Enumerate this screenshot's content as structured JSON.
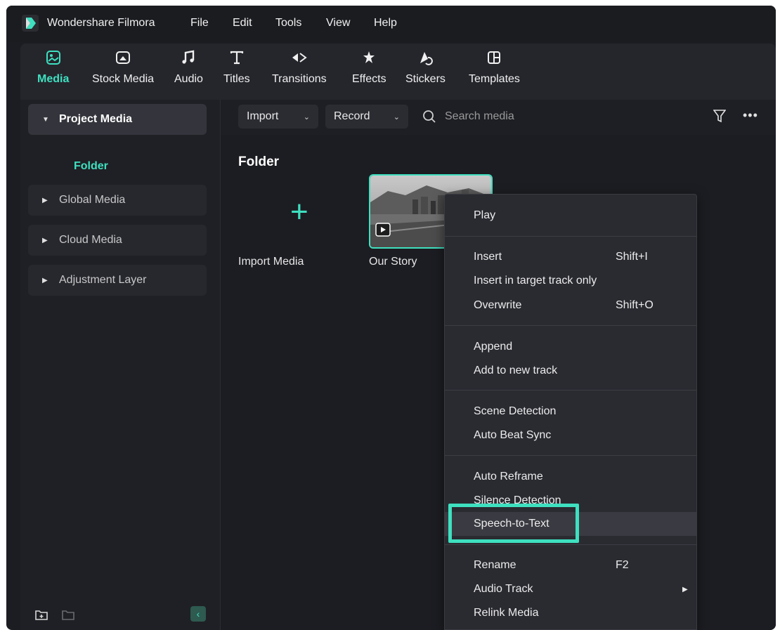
{
  "app": {
    "name": "Wondershare Filmora"
  },
  "menu": [
    "File",
    "Edit",
    "Tools",
    "View",
    "Help"
  ],
  "tabs": [
    {
      "label": "Media",
      "icon": "media-icon"
    },
    {
      "label": "Stock Media",
      "icon": "stock-media-icon"
    },
    {
      "label": "Audio",
      "icon": "audio-icon"
    },
    {
      "label": "Titles",
      "icon": "titles-icon"
    },
    {
      "label": "Transitions",
      "icon": "transitions-icon"
    },
    {
      "label": "Effects",
      "icon": "effects-icon"
    },
    {
      "label": "Stickers",
      "icon": "stickers-icon"
    },
    {
      "label": "Templates",
      "icon": "templates-icon"
    }
  ],
  "sidebar": {
    "items": [
      {
        "label": "Project Media"
      },
      {
        "label": "Global Media"
      },
      {
        "label": "Cloud Media"
      },
      {
        "label": "Adjustment Layer"
      }
    ],
    "folder": "Folder"
  },
  "main": {
    "import_dropdown": "Import",
    "record_dropdown": "Record",
    "search_placeholder": "Search media",
    "folder_title": "Folder",
    "import_media_label": "Import Media",
    "clip_label": "Our Story"
  },
  "context_menu": {
    "items": [
      {
        "label": "Play",
        "shortcut": ""
      },
      {
        "label": "Insert",
        "shortcut": "Shift+I"
      },
      {
        "label": "Insert in target track only",
        "shortcut": ""
      },
      {
        "label": "Overwrite",
        "shortcut": "Shift+O"
      },
      {
        "label": "Append",
        "shortcut": ""
      },
      {
        "label": "Add to new track",
        "shortcut": ""
      },
      {
        "label": "Scene Detection",
        "shortcut": ""
      },
      {
        "label": "Auto Beat Sync",
        "shortcut": ""
      },
      {
        "label": "Auto Reframe",
        "shortcut": ""
      },
      {
        "label": "Silence Detection",
        "shortcut": ""
      },
      {
        "label": "Speech-to-Text",
        "shortcut": ""
      },
      {
        "label": "Rename",
        "shortcut": "F2"
      },
      {
        "label": "Audio Track",
        "shortcut": ""
      },
      {
        "label": "Relink Media",
        "shortcut": ""
      }
    ]
  },
  "colors": {
    "accent": "#3ee0c0",
    "background": "#1c1d22",
    "menu": "#2a2b31"
  }
}
